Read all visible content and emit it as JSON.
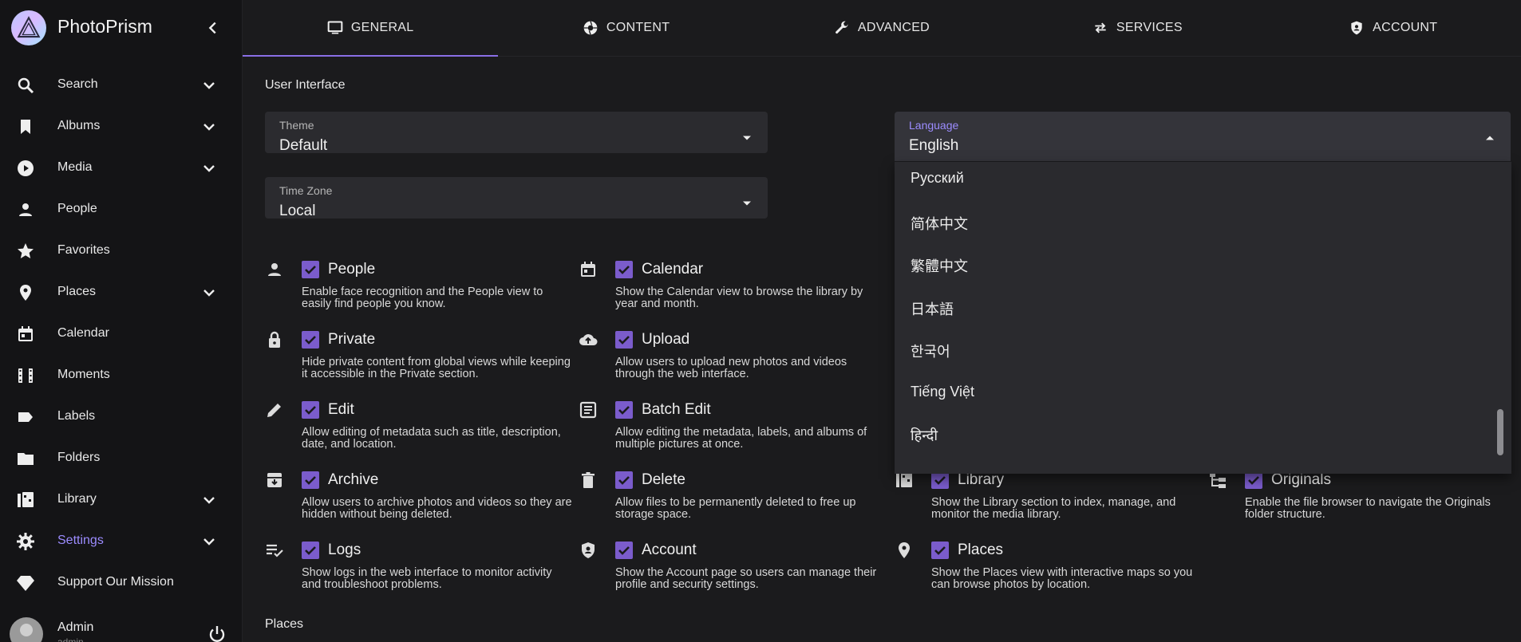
{
  "app": {
    "title": "PhotoPrism"
  },
  "sidebar": {
    "items": [
      {
        "label": "Search",
        "icon": "search-icon",
        "has_chevron": true
      },
      {
        "label": "Albums",
        "icon": "bookmark-icon",
        "has_chevron": true
      },
      {
        "label": "Media",
        "icon": "play-circle-icon",
        "has_chevron": true
      },
      {
        "label": "People",
        "icon": "person-icon",
        "has_chevron": false
      },
      {
        "label": "Favorites",
        "icon": "star-icon",
        "has_chevron": false
      },
      {
        "label": "Places",
        "icon": "place-marker-icon",
        "has_chevron": true
      },
      {
        "label": "Calendar",
        "icon": "calendar-icon",
        "has_chevron": false
      },
      {
        "label": "Moments",
        "icon": "film-icon",
        "has_chevron": false
      },
      {
        "label": "Labels",
        "icon": "label-icon",
        "has_chevron": false
      },
      {
        "label": "Folders",
        "icon": "folder-icon",
        "has_chevron": false
      },
      {
        "label": "Library",
        "icon": "library-icon",
        "has_chevron": true
      },
      {
        "label": "Settings",
        "icon": "gear-icon",
        "has_chevron": true,
        "active": true
      },
      {
        "label": "Support Our Mission",
        "icon": "diamond-icon",
        "has_chevron": false
      }
    ],
    "user": {
      "name": "Admin",
      "sub": "admin"
    }
  },
  "tabs": [
    {
      "label": "GENERAL",
      "icon": "monitor-icon",
      "active": true
    },
    {
      "label": "CONTENT",
      "icon": "aperture-icon"
    },
    {
      "label": "ADVANCED",
      "icon": "wrench-icon"
    },
    {
      "label": "SERVICES",
      "icon": "swap-arrows-icon"
    },
    {
      "label": "ACCOUNT",
      "icon": "shield-account-icon"
    }
  ],
  "ui": {
    "section_title": "User Interface",
    "theme": {
      "label": "Theme",
      "value": "Default"
    },
    "timezone": {
      "label": "Time Zone",
      "value": "Local"
    },
    "language": {
      "label": "Language",
      "value": "English"
    },
    "language_options": [
      "Русский",
      "简体中文",
      "繁體中文",
      "日本語",
      "한국어",
      "Tiếng Việt",
      "हिन्दी"
    ]
  },
  "options": [
    {
      "title": "People",
      "desc": "Enable face recognition and the People view to easily find people you know.",
      "icon": "person-icon"
    },
    {
      "title": "Calendar",
      "desc": "Show the Calendar view to browse the library by year and month.",
      "icon": "calendar-icon"
    },
    {
      "title": "Private",
      "desc": "Hide private content from global views while keeping it accessible in the Private section.",
      "icon": "lock-icon"
    },
    {
      "title": "Upload",
      "desc": "Allow users to upload new photos and videos through the web interface.",
      "icon": "cloud-upload-icon"
    },
    {
      "title": "Edit",
      "desc": "Allow editing of metadata such as title, description, date, and location.",
      "icon": "pencil-icon"
    },
    {
      "title": "Batch Edit",
      "desc": "Allow editing the metadata, labels, and albums of multiple pictures at once.",
      "icon": "batch-edit-icon"
    },
    {
      "title": "Archive",
      "desc": "Allow users to archive photos and videos so they are hidden without being deleted.",
      "icon": "archive-icon"
    },
    {
      "title": "Delete",
      "desc": "Allow files to be permanently deleted to free up storage space.",
      "icon": "trash-icon"
    },
    {
      "title": "Library",
      "desc": "Show the Library section to index, manage, and monitor the media library.",
      "icon": "library-icon"
    },
    {
      "title": "Originals",
      "desc": "Enable the file browser to navigate the Originals folder structure.",
      "icon": "folder-tree-icon"
    },
    {
      "title": "Logs",
      "desc": "Show logs in the web interface to monitor activity and troubleshoot problems.",
      "icon": "logs-icon"
    },
    {
      "title": "Account",
      "desc": "Show the Account page so users can manage their profile and security settings.",
      "icon": "shield-account-icon"
    },
    {
      "title": "Places",
      "desc": "Show the Places view with interactive maps so you can browse photos by location.",
      "icon": "place-marker-icon"
    }
  ],
  "places_section_title": "Places",
  "colors": {
    "accent": "#7b5ccc",
    "accent_text": "#9c8cff",
    "bg": "#1b1b1d",
    "sidebar_bg": "#141416",
    "field_bg": "#2b2b2f"
  }
}
